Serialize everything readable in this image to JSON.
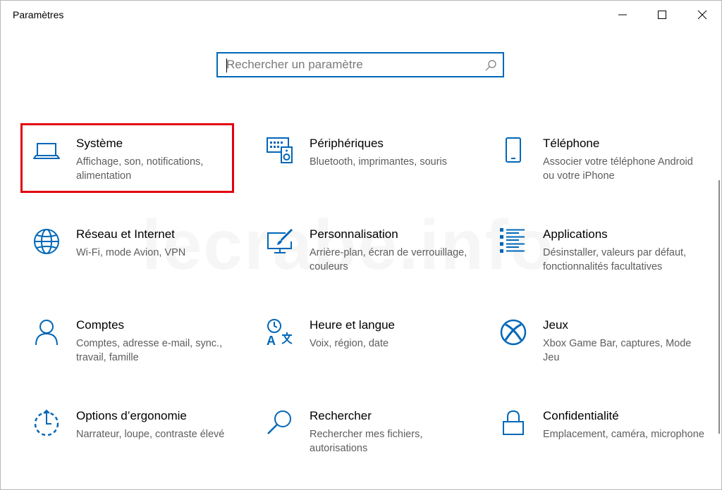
{
  "window": {
    "title": "Paramètres",
    "accent": "#0067b8",
    "highlight_color": "#e4000f"
  },
  "search": {
    "placeholder": "Rechercher un paramètre",
    "value": "",
    "icon": "search-icon"
  },
  "watermark": "lecrabe.info",
  "tiles": [
    {
      "name": "Système",
      "desc": "Affichage, son, notifications, alimentation",
      "icon": "laptop-icon"
    },
    {
      "name": "Périphériques",
      "desc": "Bluetooth, imprimantes, souris",
      "icon": "devices-icon"
    },
    {
      "name": "Téléphone",
      "desc": "Associer votre téléphone Android ou votre iPhone",
      "icon": "phone-icon"
    },
    {
      "name": "Réseau et Internet",
      "desc": "Wi-Fi, mode Avion, VPN",
      "icon": "globe-icon"
    },
    {
      "name": "Personnalisation",
      "desc": "Arrière-plan, écran de verrouillage, couleurs",
      "icon": "paint-brush-icon"
    },
    {
      "name": "Applications",
      "desc": "Désinstaller, valeurs par défaut, fonctionnalités facultatives",
      "icon": "apps-list-icon"
    },
    {
      "name": "Comptes",
      "desc": "Comptes, adresse e-mail, sync., travail, famille",
      "icon": "person-icon"
    },
    {
      "name": "Heure et langue",
      "desc": "Voix, région, date",
      "icon": "time-language-icon"
    },
    {
      "name": "Jeux",
      "desc": "Xbox Game Bar, captures, Mode Jeu",
      "icon": "xbox-icon"
    },
    {
      "name": "Options d’ergonomie",
      "desc": "Narrateur, loupe, contraste élevé",
      "icon": "ease-of-access-icon"
    },
    {
      "name": "Rechercher",
      "desc": "Rechercher mes fichiers, autorisations",
      "icon": "magnifier-icon"
    },
    {
      "name": "Confidentialité",
      "desc": "Emplacement, caméra, microphone",
      "icon": "lock-icon"
    }
  ]
}
